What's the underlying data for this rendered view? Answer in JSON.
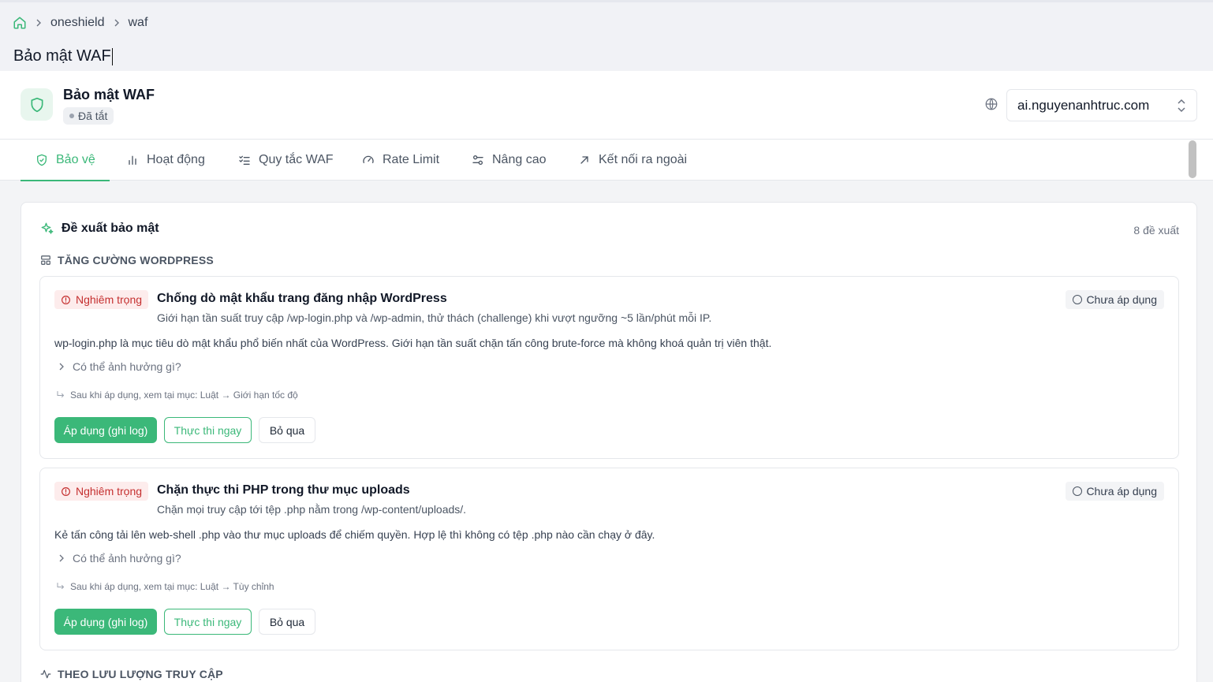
{
  "breadcrumb": {
    "home_icon": "home-icon",
    "items": [
      "oneshield",
      "waf"
    ]
  },
  "page_title": "Bảo mật WAF",
  "header": {
    "title": "Bảo mật WAF",
    "status": "Đã tắt",
    "domain_value": "ai.nguyenanhtruc.com"
  },
  "tabs": [
    {
      "label": "Bảo vệ",
      "icon": "shield-check-icon",
      "active": true
    },
    {
      "label": "Hoạt động",
      "icon": "bar-chart-icon",
      "active": false
    },
    {
      "label": "Quy tắc WAF",
      "icon": "list-check-icon",
      "active": false
    },
    {
      "label": "Rate Limit",
      "icon": "gauge-icon",
      "active": false
    },
    {
      "label": "Nâng cao",
      "icon": "sliders-icon",
      "active": false
    },
    {
      "label": "Kết nối ra ngoài",
      "icon": "arrow-up-right-icon",
      "active": false
    }
  ],
  "recommendations": {
    "title": "Đề xuất bảo mật",
    "count": "8 đề xuất",
    "groups": [
      {
        "label": "TĂNG CƯỜNG WORDPRESS",
        "cards": [
          {
            "severity": "Nghiêm trọng",
            "title": "Chống dò mật khẩu trang đăng nhập WordPress",
            "subtitle": "Giới hạn tần suất truy cập /wp-login.php và /wp-admin, thử thách (challenge) khi vượt ngưỡng ~5 lần/phút mỗi IP.",
            "status": "Chưa áp dụng",
            "description": "wp-login.php là mục tiêu dò mật khẩu phổ biến nhất của WordPress. Giới hạn tần suất chặn tấn công brute-force mà không khoá quản trị viên thật.",
            "impact_label": "Có thể ảnh hưởng gì?",
            "after_apply": "Sau khi áp dụng, xem tại mục: Luật → Giới hạn tốc độ",
            "apply_label": "Áp dụng (ghi log)",
            "run_label": "Thực thi ngay",
            "skip_label": "Bỏ qua"
          },
          {
            "severity": "Nghiêm trọng",
            "title": "Chặn thực thi PHP trong thư mục uploads",
            "subtitle": "Chặn mọi truy cập tới tệp .php nằm trong /wp-content/uploads/.",
            "status": "Chưa áp dụng",
            "description": "Kẻ tấn công tải lên web-shell .php vào thư mục uploads để chiếm quyền. Hợp lệ thì không có tệp .php nào cần chạy ở đây.",
            "impact_label": "Có thể ảnh hưởng gì?",
            "after_apply": "Sau khi áp dụng, xem tại mục: Luật → Tùy chỉnh",
            "apply_label": "Áp dụng (ghi log)",
            "run_label": "Thực thi ngay",
            "skip_label": "Bỏ qua"
          }
        ]
      },
      {
        "label": "THEO LƯU LƯỢNG TRUY CẬP"
      }
    ]
  },
  "colors": {
    "accent": "#3bb879",
    "danger": "#c53030",
    "danger_bg": "#fdecec"
  }
}
